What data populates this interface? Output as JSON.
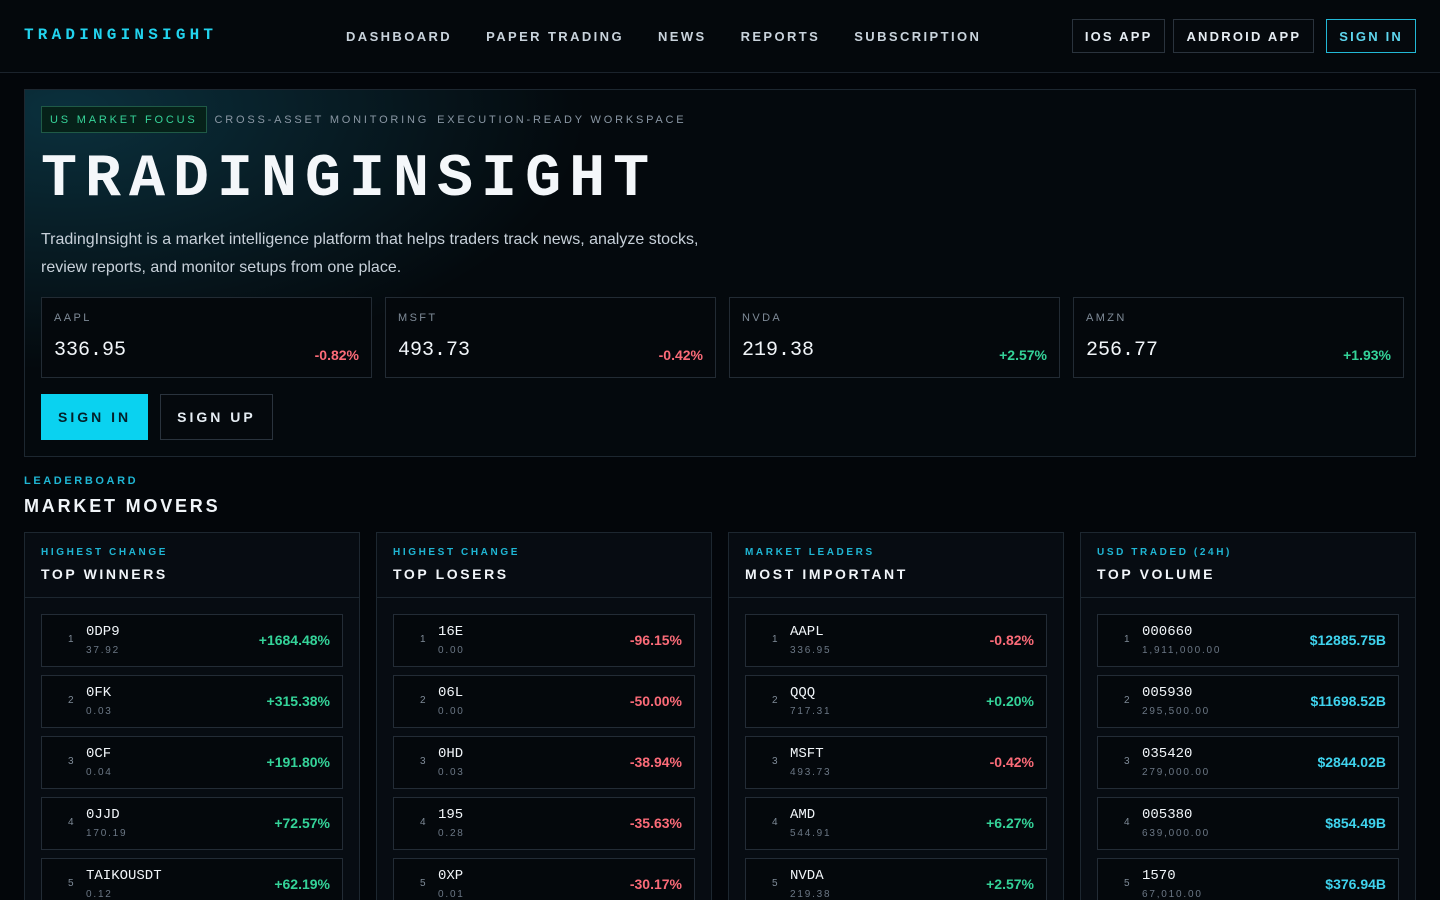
{
  "header": {
    "brand": "TRADINGINSIGHT",
    "nav": [
      "DASHBOARD",
      "PAPER TRADING",
      "NEWS",
      "REPORTS",
      "SUBSCRIPTION"
    ],
    "ios_label": "IOS APP",
    "android_label": "ANDROID APP",
    "signin_label": "SIGN IN"
  },
  "hero": {
    "tag_primary": "US MARKET FOCUS",
    "tag_secondary": "CROSS-ASSET MONITORING",
    "tag_tertiary": "EXECUTION-READY WORKSPACE",
    "title": "TRADINGINSIGHT",
    "description": "TradingInsight is a market intelligence platform that helps traders track news, analyze stocks, review reports, and monitor setups from one place.",
    "tickers": [
      {
        "symbol": "AAPL",
        "price": "336.95",
        "change": "-0.82%",
        "direction": "down"
      },
      {
        "symbol": "MSFT",
        "price": "493.73",
        "change": "-0.42%",
        "direction": "down"
      },
      {
        "symbol": "NVDA",
        "price": "219.38",
        "change": "+2.57%",
        "direction": "up"
      },
      {
        "symbol": "AMZN",
        "price": "256.77",
        "change": "+1.93%",
        "direction": "up"
      }
    ],
    "signin_label": "SIGN IN",
    "signup_label": "SIGN UP"
  },
  "leaderboard": {
    "eyebrow": "LEADERBOARD",
    "title": "MARKET MOVERS",
    "boards": [
      {
        "eyebrow": "HIGHEST CHANGE",
        "title": "TOP WINNERS",
        "rows": [
          {
            "rank": "1",
            "symbol": "0DP9",
            "sub": "37.92",
            "value": "+1684.48%",
            "tone": "pos"
          },
          {
            "rank": "2",
            "symbol": "0FK",
            "sub": "0.03",
            "value": "+315.38%",
            "tone": "pos"
          },
          {
            "rank": "3",
            "symbol": "0CF",
            "sub": "0.04",
            "value": "+191.80%",
            "tone": "pos"
          },
          {
            "rank": "4",
            "symbol": "0JJD",
            "sub": "170.19",
            "value": "+72.57%",
            "tone": "pos"
          },
          {
            "rank": "5",
            "symbol": "TAIKOUSDT",
            "sub": "0.12",
            "value": "+62.19%",
            "tone": "pos"
          }
        ]
      },
      {
        "eyebrow": "HIGHEST CHANGE",
        "title": "TOP LOSERS",
        "rows": [
          {
            "rank": "1",
            "symbol": "16E",
            "sub": "0.00",
            "value": "-96.15%",
            "tone": "neg"
          },
          {
            "rank": "2",
            "symbol": "06L",
            "sub": "0.00",
            "value": "-50.00%",
            "tone": "neg"
          },
          {
            "rank": "3",
            "symbol": "0HD",
            "sub": "0.03",
            "value": "-38.94%",
            "tone": "neg"
          },
          {
            "rank": "4",
            "symbol": "195",
            "sub": "0.28",
            "value": "-35.63%",
            "tone": "neg"
          },
          {
            "rank": "5",
            "symbol": "0XP",
            "sub": "0.01",
            "value": "-30.17%",
            "tone": "neg"
          }
        ]
      },
      {
        "eyebrow": "MARKET LEADERS",
        "title": "MOST IMPORTANT",
        "rows": [
          {
            "rank": "1",
            "symbol": "AAPL",
            "sub": "336.95",
            "value": "-0.82%",
            "tone": "neg"
          },
          {
            "rank": "2",
            "symbol": "QQQ",
            "sub": "717.31",
            "value": "+0.20%",
            "tone": "pos"
          },
          {
            "rank": "3",
            "symbol": "MSFT",
            "sub": "493.73",
            "value": "-0.42%",
            "tone": "neg"
          },
          {
            "rank": "4",
            "symbol": "AMD",
            "sub": "544.91",
            "value": "+6.27%",
            "tone": "pos"
          },
          {
            "rank": "5",
            "symbol": "NVDA",
            "sub": "219.38",
            "value": "+2.57%",
            "tone": "pos"
          }
        ]
      },
      {
        "eyebrow": "USD TRADED (24H)",
        "title": "TOP VOLUME",
        "rows": [
          {
            "rank": "1",
            "symbol": "000660",
            "sub": "1,911,000.00",
            "value": "$12885.75B",
            "tone": "cyan"
          },
          {
            "rank": "2",
            "symbol": "005930",
            "sub": "295,500.00",
            "value": "$11698.52B",
            "tone": "cyan"
          },
          {
            "rank": "3",
            "symbol": "035420",
            "sub": "279,000.00",
            "value": "$2844.02B",
            "tone": "cyan"
          },
          {
            "rank": "4",
            "symbol": "005380",
            "sub": "639,000.00",
            "value": "$854.49B",
            "tone": "cyan"
          },
          {
            "rank": "5",
            "symbol": "1570",
            "sub": "67,010.00",
            "value": "$376.94B",
            "tone": "cyan"
          }
        ]
      }
    ]
  },
  "colors": {
    "accent": "#22d3ee",
    "positive": "#34d399",
    "negative": "#fb6b78",
    "background": "#03060a"
  }
}
